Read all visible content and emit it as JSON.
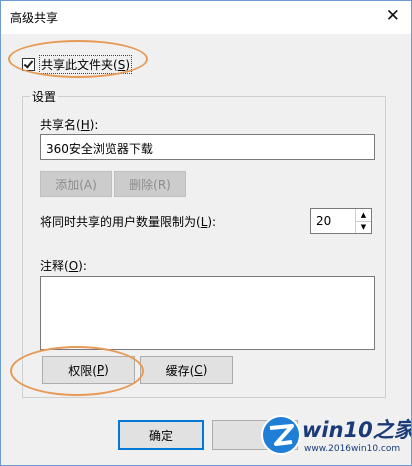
{
  "window": {
    "title": "高级共享",
    "close_glyph": "✕"
  },
  "share_checkbox": {
    "label": "共享此文件夹(",
    "mnemonic": "S",
    "suffix": ")",
    "checked": true
  },
  "settings": {
    "group_label": "设置",
    "share_name_label": "共享名(",
    "share_name_mnemonic": "H",
    "share_name_suffix": "):",
    "share_name_value": "360安全浏览器下载",
    "add_button": "添加(A)",
    "remove_button": "删除(R)",
    "user_limit_label": "将同时共享的用户数量限制为(",
    "user_limit_mnemonic": "L",
    "user_limit_suffix": "):",
    "user_limit_value": "20",
    "comment_label": "注释(",
    "comment_mnemonic": "O",
    "comment_suffix": "):",
    "comment_value": "",
    "permissions_button": "权限(",
    "permissions_mnemonic": "P",
    "permissions_suffix": ")",
    "cache_button": "缓存(",
    "cache_mnemonic": "C",
    "cache_suffix": ")"
  },
  "footer": {
    "ok_button": "确定"
  },
  "watermark": {
    "text": "win10之家",
    "url": "www.2016win10.com"
  },
  "colors": {
    "accent": "#0078d7",
    "highlight_ring": "#e69a56",
    "watermark": "#1a3b78"
  }
}
